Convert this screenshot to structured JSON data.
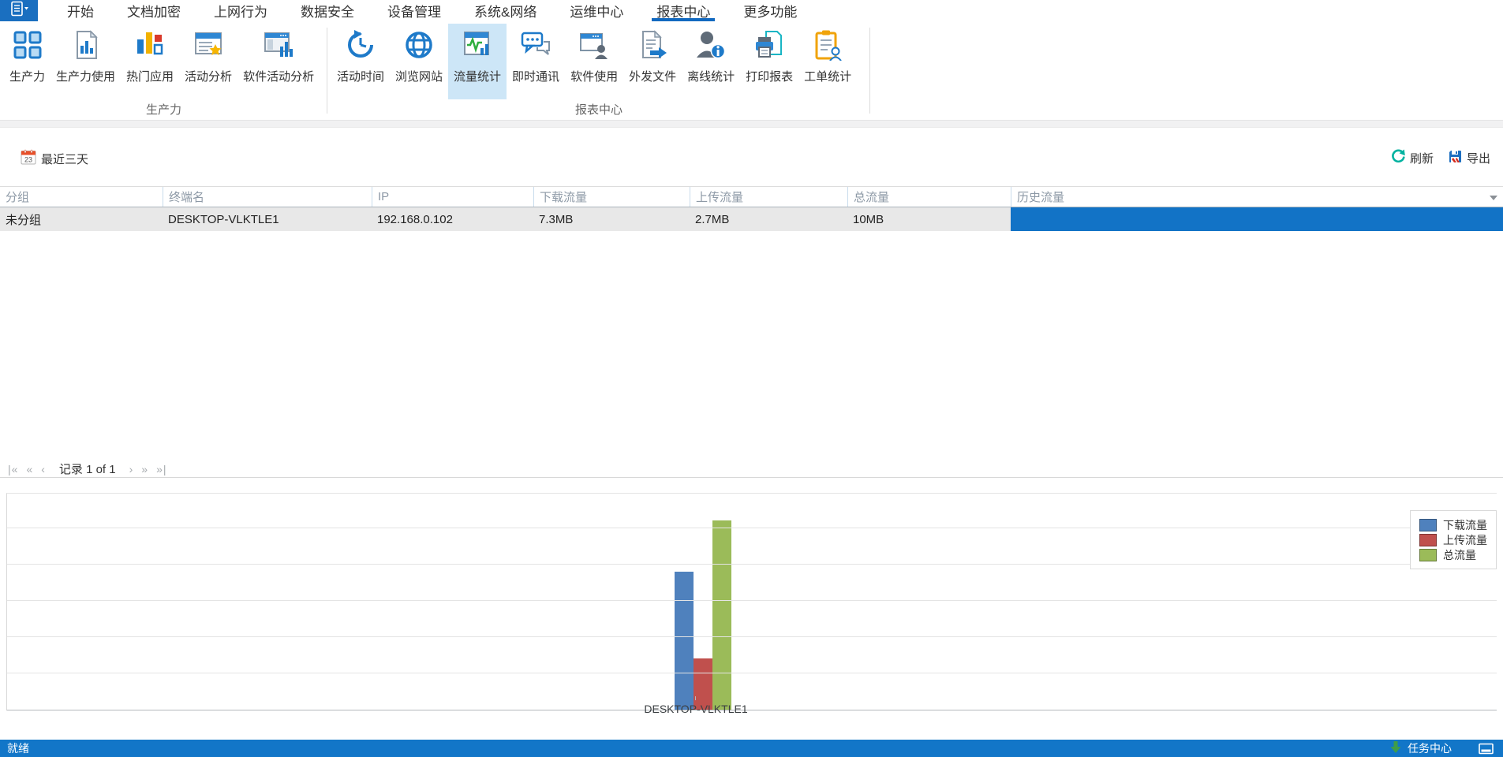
{
  "menubar": {
    "tabs": [
      "开始",
      "文档加密",
      "上网行为",
      "数据安全",
      "设备管理",
      "系统&网络",
      "运维中心",
      "报表中心",
      "更多功能"
    ],
    "active_tab": "报表中心"
  },
  "ribbon": {
    "groups": [
      {
        "label": "生产力",
        "buttons": [
          {
            "label": "生产力",
            "icon": "productivity-grid-icon"
          },
          {
            "label": "生产力使用",
            "icon": "productivity-usage-icon"
          },
          {
            "label": "热门应用",
            "icon": "hot-apps-icon"
          },
          {
            "label": "活动分析",
            "icon": "activity-analysis-icon"
          },
          {
            "label": "软件活动分析",
            "icon": "software-activity-icon"
          }
        ]
      },
      {
        "label": "报表中心",
        "buttons": [
          {
            "label": "活动时间",
            "icon": "active-time-icon"
          },
          {
            "label": "浏览网站",
            "icon": "browse-website-icon"
          },
          {
            "label": "流量统计",
            "icon": "traffic-stats-icon",
            "selected": true
          },
          {
            "label": "即时通讯",
            "icon": "instant-message-icon"
          },
          {
            "label": "软件使用",
            "icon": "software-usage-icon"
          },
          {
            "label": "外发文件",
            "icon": "outgoing-file-icon"
          },
          {
            "label": "离线统计",
            "icon": "offline-stats-icon"
          },
          {
            "label": "打印报表",
            "icon": "print-report-icon"
          },
          {
            "label": "工单统计",
            "icon": "work-order-icon"
          }
        ]
      }
    ]
  },
  "toolbar": {
    "date_filter": "最近三天",
    "refresh_label": "刷新",
    "export_label": "导出"
  },
  "table": {
    "columns": [
      "分组",
      "终端名",
      "IP",
      "下载流量",
      "上传流量",
      "总流量",
      "历史流量"
    ],
    "rows": [
      {
        "group": "未分组",
        "terminal": "DESKTOP-VLKTLE1",
        "ip": "192.168.0.102",
        "download": "7.3MB",
        "upload": "2.7MB",
        "total": "10MB",
        "history_bar_fill": 1.0
      }
    ],
    "history_bar_color": "#1273c6"
  },
  "pagination": {
    "label": "记录 1 of 1",
    "nav_left": [
      "|«",
      "«",
      "‹"
    ],
    "nav_right": [
      "›",
      "»",
      "»|"
    ]
  },
  "chart_data": {
    "type": "bar",
    "categories": [
      "DESKTOP-VLKTLE1"
    ],
    "series": [
      {
        "name": "下载流量",
        "values": [
          7.3
        ],
        "color": "#4f81bd"
      },
      {
        "name": "上传流量",
        "values": [
          2.7
        ],
        "color": "#c0504d"
      },
      {
        "name": "总流量",
        "values": [
          10
        ],
        "color": "#9bbb59"
      }
    ],
    "unit": "MB",
    "title": "",
    "xlabel": "",
    "ylabel": "",
    "ylim": [
      0,
      11.5
    ],
    "grid": true,
    "legend_position": "right-top"
  },
  "statusbar": {
    "ready": "就绪",
    "task_center": "任务中心"
  },
  "colors": {
    "accent": "#1276c8",
    "ribbon_highlight": "#cde6f7",
    "active_tab_underline": "#1269c0",
    "row_bg": "#e8e8e8"
  }
}
